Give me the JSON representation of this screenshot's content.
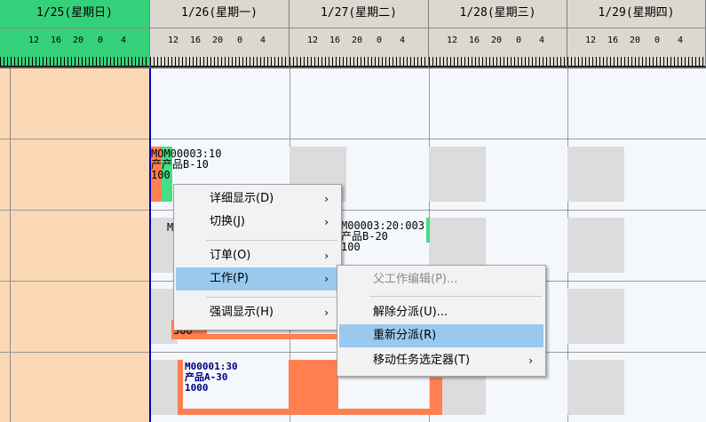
{
  "header": {
    "days": [
      {
        "label": "1/25(星期日)"
      },
      {
        "label": "1/26(星期一)"
      },
      {
        "label": "1/27(星期二)"
      },
      {
        "label": "1/28(星期三)"
      },
      {
        "label": "1/29(星期四)"
      }
    ],
    "hours": [
      "12",
      "16",
      "20",
      "0",
      "4"
    ]
  },
  "tasks": {
    "task1": {
      "line1": "MOM00003:10",
      "line2": "产产品B-10",
      "line3": "100"
    },
    "task2": {
      "line1": "M00003:20:003",
      "line2": "产品B-20",
      "line3": "100"
    },
    "task3": {
      "line1": "M00001:30",
      "line2": "产品A-30",
      "line3": "1000"
    },
    "task4": {
      "line1": "M",
      "line3": "300"
    }
  },
  "context_menu": {
    "items": [
      {
        "label": "详细显示(D)",
        "arrow": "›"
      },
      {
        "label": "切换(J)",
        "arrow": "›"
      },
      {
        "label": "订单(O)",
        "arrow": "›"
      },
      {
        "label": "工作(P)",
        "arrow": "›"
      },
      {
        "label": "强调显示(H)",
        "arrow": "›"
      }
    ]
  },
  "submenu": {
    "items": [
      {
        "label": "父工作编辑(P)..."
      },
      {
        "label": "解除分派(U)..."
      },
      {
        "label": "重新分派(R)"
      },
      {
        "label": "移动任务选定器(T)",
        "arrow": "›"
      }
    ]
  },
  "colors": {
    "today_header": "#35d17a",
    "header": "#dcd8d0",
    "task_bar": "#ff7f50",
    "menu_highlight": "#99c9ef"
  }
}
